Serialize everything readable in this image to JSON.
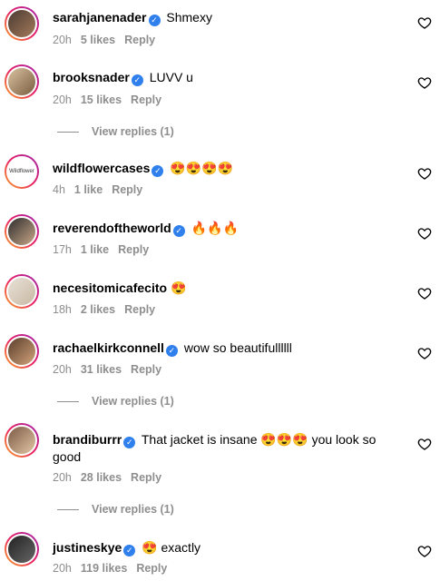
{
  "comments": [
    {
      "user": "sarahjanenader",
      "text": "Shmexy",
      "time": "20h",
      "likes": "5 likes",
      "reply": "Reply",
      "colors": [
        "#4a3b32",
        "#a57a5a"
      ]
    },
    {
      "user": "brooksnader",
      "text": "LUVV u",
      "time": "20h",
      "likes": "15 likes",
      "reply": "Reply",
      "colors": [
        "#d8c2a0",
        "#7a5c40"
      ]
    },
    {
      "user": "wildflowercases",
      "text": "😍😍😍😍",
      "time": "4h",
      "likes": "1 like",
      "reply": "Reply",
      "colors": [
        "#ffffff",
        "#ffffff"
      ],
      "avatar_text": "Wildflower"
    },
    {
      "user": "reverendoftheworld",
      "text": "🔥🔥🔥",
      "time": "17h",
      "likes": "1 like",
      "reply": "Reply",
      "colors": [
        "#2d2d2d",
        "#c9a688"
      ]
    },
    {
      "user": "necesitomicafecito",
      "text": "😍",
      "time": "18h",
      "likes": "2 likes",
      "reply": "Reply",
      "colors": [
        "#e8e1d8",
        "#c8b8a2"
      ]
    },
    {
      "user": "rachaelkirkconnell",
      "text": "wow so beautifullllll",
      "time": "20h",
      "likes": "31 likes",
      "reply": "Reply",
      "colors": [
        "#5a3e2b",
        "#d2a37b"
      ]
    },
    {
      "user": "brandiburrr",
      "text": "That jacket is insane 😍😍😍 you look so good",
      "time": "20h",
      "likes": "28 likes",
      "reply": "Reply",
      "colors": [
        "#7b5a44",
        "#e3c6a6"
      ]
    },
    {
      "user": "justineskye",
      "text": "😍 exactly",
      "time": "20h",
      "likes": "119 likes",
      "reply": "Reply",
      "colors": [
        "#222222",
        "#666666"
      ]
    }
  ],
  "view_replies": "View replies (1)"
}
